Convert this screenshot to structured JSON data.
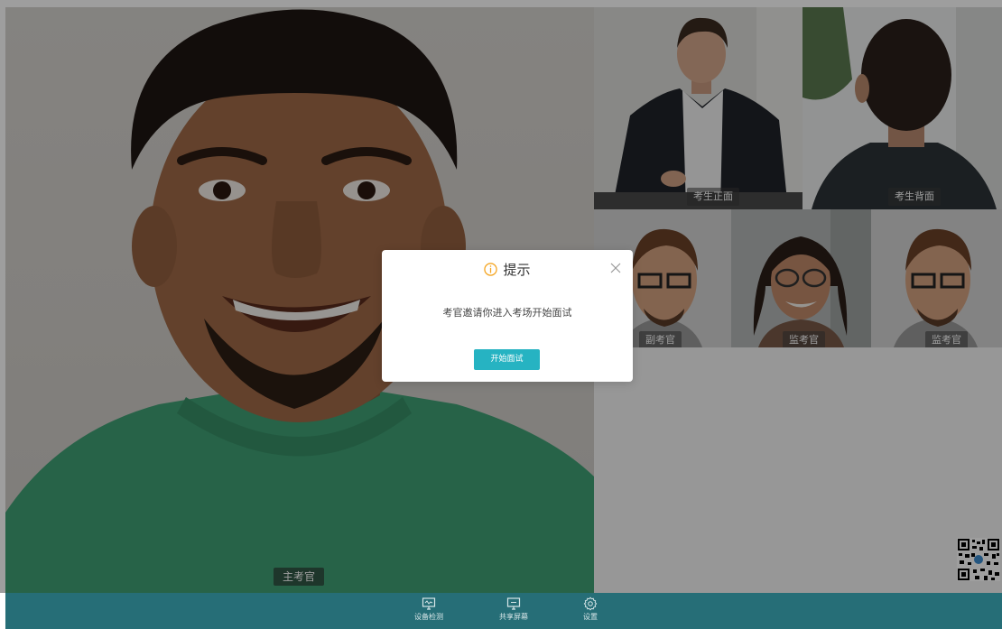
{
  "videos": {
    "main_label": "主考官",
    "front_label": "考生正面",
    "back_label": "考生背面",
    "deputy_label": "副考官",
    "monitor1_label": "监考官",
    "monitor2_label": "监考官"
  },
  "dialog": {
    "title": "提示",
    "message": "考官邀请你进入考场开始面试",
    "button": "开始面试"
  },
  "toolbar": {
    "device_check": "设备检测",
    "share_screen": "共享屏幕",
    "settings": "设置"
  },
  "colors": {
    "accent": "#26b3c2",
    "toolbar_bg": "#266e77",
    "warning": "#f5a623"
  }
}
